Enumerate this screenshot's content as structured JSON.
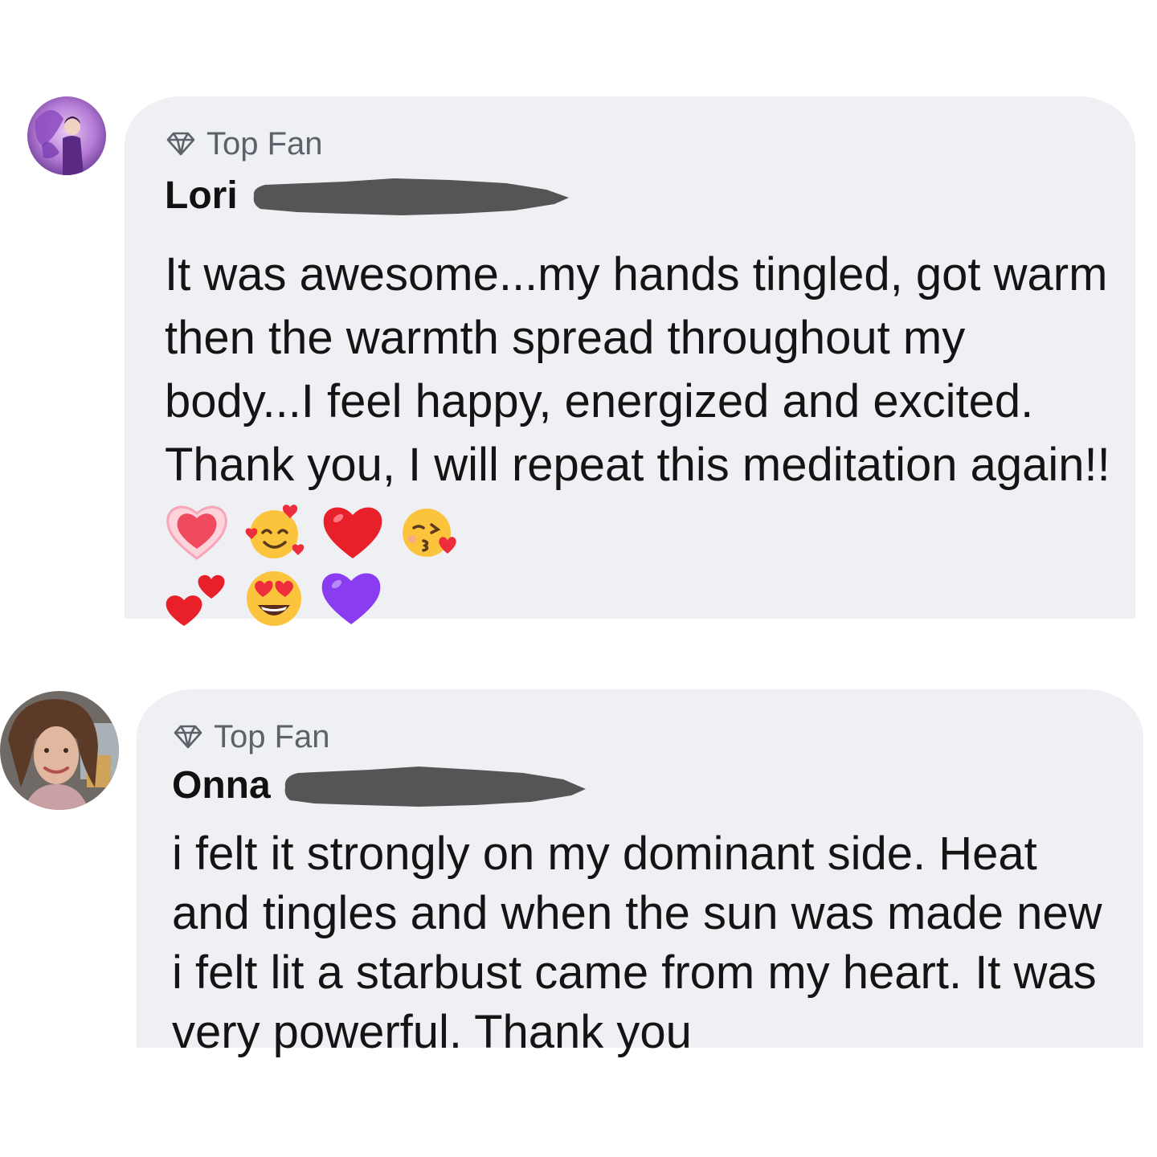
{
  "comments": [
    {
      "badge": "Top Fan",
      "author": "Lori",
      "text": "It was awesome...my hands tingled, got warm then the warmth spread throughout my body...I feel happy, energized and excited. Thank you, I will repeat this meditation again!!",
      "emojis": [
        "sparkling-heart",
        "smiling-face-with-hearts",
        "red-heart",
        "face-blowing-kiss",
        "two-hearts",
        "heart-eyes",
        "purple-heart"
      ]
    },
    {
      "badge": "Top Fan",
      "author": "Onna",
      "text": "i felt it strongly on my dominant side. Heat and tingles and when the sun was made new i felt lit a starbust came from my heart. It was very powerful. Thank you"
    }
  ]
}
